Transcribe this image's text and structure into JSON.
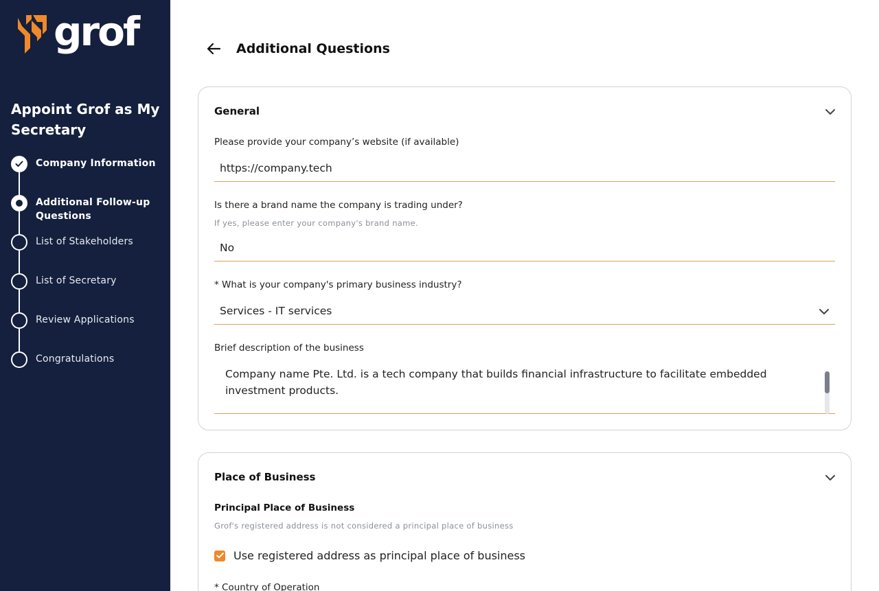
{
  "brand": {
    "name": "grof",
    "accent_color": "#f0892a",
    "sidebar_color": "#14203d"
  },
  "sidebar": {
    "title": "Appoint Grof as My Secretary",
    "steps": [
      {
        "label": "Company Information",
        "state": "done"
      },
      {
        "label": "Additional Follow-up Questions",
        "state": "active"
      },
      {
        "label": "List of Stakeholders",
        "state": "pending"
      },
      {
        "label": "List of Secretary",
        "state": "pending"
      },
      {
        "label": "Review Applications",
        "state": "pending"
      },
      {
        "label": "Congratulations",
        "state": "pending"
      }
    ]
  },
  "header": {
    "back_icon": "arrow-left-icon",
    "title": "Additional Questions"
  },
  "general": {
    "title": "General",
    "website": {
      "label": "Please provide your company’s website (if available)",
      "value": "https://company.tech"
    },
    "brand_name": {
      "label": "Is there a brand name the company is trading under?",
      "hint": "If yes, please enter your company's brand name.",
      "value": "No"
    },
    "industry": {
      "label": "* What is your company's primary business industry?",
      "value": "Services - IT services"
    },
    "description": {
      "label": "Brief description of the business",
      "value": "Company name Pte. Ltd. is a tech company that builds financial infrastructure to facilitate embedded investment products."
    }
  },
  "place_of_business": {
    "title": "Place of Business",
    "subtitle": "Principal Place of Business",
    "hint": "Grof's registered address is not considered a principal place of business",
    "checkbox_label": "Use registered address as principal place of business",
    "checkbox_checked": true,
    "country_label": "* Country of Operation"
  }
}
